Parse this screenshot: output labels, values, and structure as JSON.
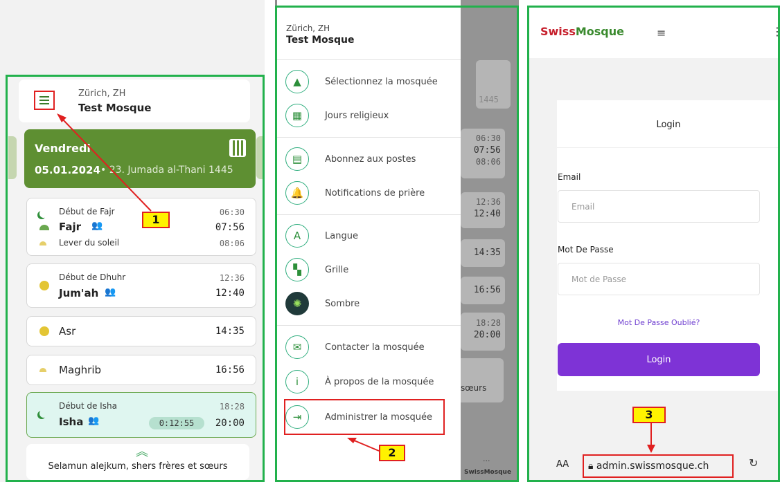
{
  "panel1": {
    "city": "Zürich, ZH",
    "mosque": "Test Mosque",
    "day": "Vendredi",
    "date": "05.01.2024",
    "hijri": " • 23. Jumada al-Thani 1445",
    "prayers": [
      {
        "start_label": "Début de Fajr",
        "start_time": "06:30",
        "name": "Fajr",
        "time": "07:56",
        "extra_label": "Lever du soleil",
        "extra_time": "08:06"
      },
      {
        "start_label": "Début de Dhuhr",
        "start_time": "12:36",
        "name": "Jum'ah",
        "time": "12:40"
      },
      {
        "name": "Asr",
        "time": "14:35"
      },
      {
        "name": "Maghrib",
        "time": "16:56"
      },
      {
        "start_label": "Début de Isha",
        "start_time": "18:28",
        "name": "Isha",
        "time": "20:00",
        "countdown": "0:12:55"
      }
    ],
    "greeting": "Selamun alejkum, shers frères et sœurs",
    "callout": "1"
  },
  "panel2": {
    "city": "Zürich, ZH",
    "mosque": "Test Mosque",
    "menu": [
      "Sélectionnez la mosquée",
      "Jours religieux",
      "Abonnez aux postes",
      "Notifications de prière",
      "Langue",
      "Grille",
      "Sombre",
      "Contacter la mosquée",
      "À propos de la mosquée",
      "Administrer la mosquée"
    ],
    "bg_year": "1445",
    "bg_times": [
      "06:30",
      "07:56",
      "08:06",
      "12:36",
      "12:40",
      "14:35",
      "16:56",
      "18:28",
      "20:00"
    ],
    "bg_text": "sœurs",
    "bg_tab": "SwissMosque",
    "bg_dots": "···",
    "callout": "2"
  },
  "panel3": {
    "brand_a": "Swiss",
    "brand_b": "Mosque",
    "title": "Login",
    "email_label": "Email",
    "email_placeholder": "Email",
    "password_label": "Mot De Passe",
    "password_placeholder": "Mot de Passe",
    "forgot": "Mot De Passe Oublié?",
    "login_button": "Login",
    "aa": "AA",
    "url": "admin.swissmosque.ch",
    "callout": "3"
  },
  "colors": {
    "frame": "#22b14c",
    "accent_green": "#5e8f32",
    "purple": "#7e33d6",
    "callout_yellow": "#fff200",
    "callout_red": "#e02020"
  }
}
